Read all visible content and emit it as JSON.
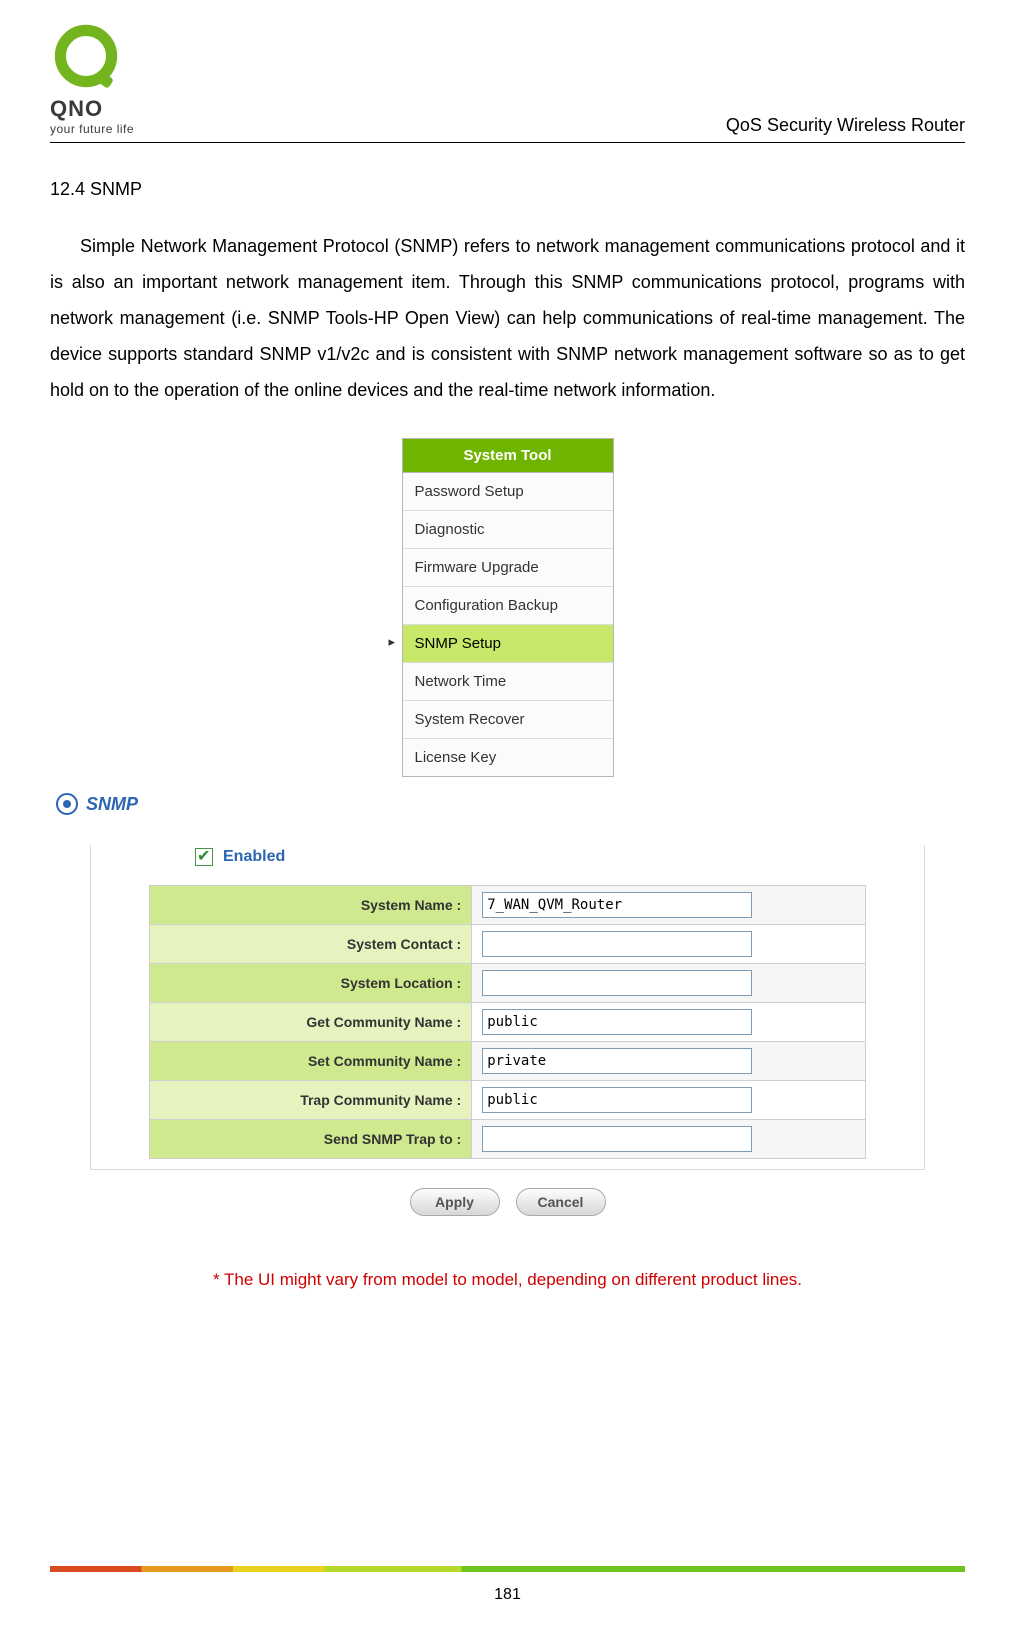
{
  "header": {
    "logo_text": "QNO",
    "logo_tagline": "your future life",
    "doc_title": "QoS Security Wireless Router"
  },
  "section": {
    "number_title": "12.4 SNMP",
    "body": "Simple Network Management Protocol (SNMP) refers to network management communications protocol and it is also an important network management item. Through this SNMP communications protocol, programs with network management (i.e. SNMP Tools-HP Open View) can help communications of real-time management. The device supports standard SNMP v1/v2c and is consistent with SNMP network management software so as to get hold on to the operation of the online devices and the real-time network information."
  },
  "menu": {
    "title": "System Tool",
    "items": [
      {
        "label": "Password Setup",
        "active": false
      },
      {
        "label": "Diagnostic",
        "active": false
      },
      {
        "label": "Firmware Upgrade",
        "active": false
      },
      {
        "label": "Configuration Backup",
        "active": false
      },
      {
        "label": "SNMP Setup",
        "active": true
      },
      {
        "label": "Network Time",
        "active": false
      },
      {
        "label": "System Recover",
        "active": false
      },
      {
        "label": "License Key",
        "active": false
      }
    ]
  },
  "snmp": {
    "panel_title": "SNMP",
    "enabled_label": "Enabled",
    "enabled_checked": true,
    "fields": [
      {
        "label": "System Name :",
        "value": "7_WAN_QVM_Router"
      },
      {
        "label": "System Contact :",
        "value": ""
      },
      {
        "label": "System Location :",
        "value": ""
      },
      {
        "label": "Get Community Name :",
        "value": "public"
      },
      {
        "label": "Set Community Name :",
        "value": "private"
      },
      {
        "label": "Trap Community Name :",
        "value": "public"
      },
      {
        "label": "Send SNMP Trap to :",
        "value": ""
      }
    ],
    "buttons": {
      "apply": "Apply",
      "cancel": "Cancel"
    }
  },
  "note": "* The UI might vary from model to model, depending on different product lines.",
  "page_number": "181"
}
